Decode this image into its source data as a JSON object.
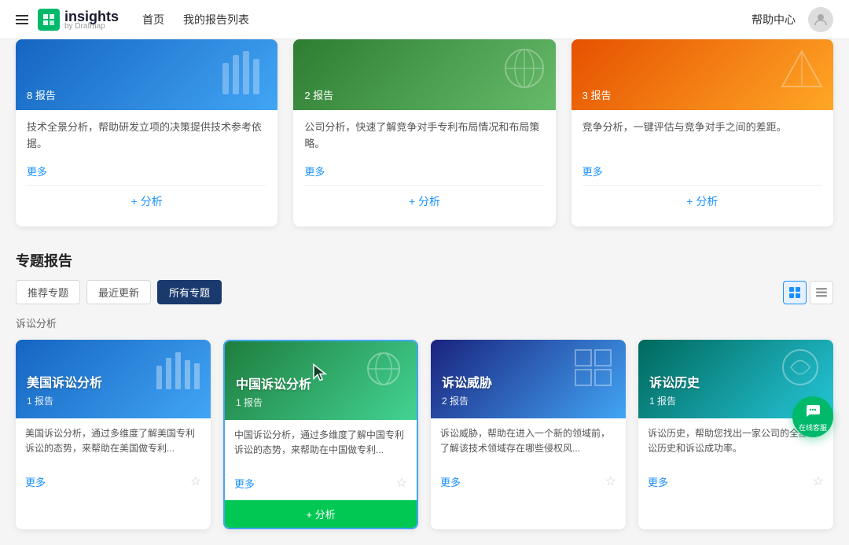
{
  "header": {
    "logo_text": "insights",
    "logo_sub": "by Drafmap",
    "nav_home": "首页",
    "nav_reports": "我的报告列表",
    "help": "帮助中心"
  },
  "top_cards": [
    {
      "report_count": "8 报告",
      "description": "技术全景分析，帮助研发立项的决策提供技术参考依据。",
      "more": "更多",
      "analyze": "+ 分析",
      "color": "blue"
    },
    {
      "report_count": "2 报告",
      "description": "公司分析，快速了解竞争对手专利布局情况和布局策略。",
      "more": "更多",
      "analyze": "+ 分析",
      "color": "green"
    },
    {
      "report_count": "3 报告",
      "description": "竞争分析，一键评估与竞争对手之间的差距。",
      "more": "更多",
      "analyze": "+ 分析",
      "color": "orange"
    }
  ],
  "section": {
    "title": "专题报告",
    "tabs": [
      "推荐专题",
      "最近更新",
      "所有专题"
    ],
    "active_tab": "所有专题",
    "category": "诉讼分析"
  },
  "report_cards": [
    {
      "title": "美国诉讼分析",
      "badge": "1 报告",
      "description": "美国诉讼分析，通过多维度了解美国专利诉讼的态势，来帮助在美国做专利...",
      "more": "更多",
      "color": "blue"
    },
    {
      "title": "中国诉讼分析",
      "badge": "1 报告",
      "description": "中国诉讼分析，通过多维度了解中国专利诉讼的态势，来帮助在中国做专利...",
      "more": "更多",
      "color": "green",
      "highlighted": true
    },
    {
      "title": "诉讼威胁",
      "badge": "2 报告",
      "description": "诉讼威胁，帮助在进入一个新的领域前，了解该技术领域存在哪些侵权风...",
      "more": "更多",
      "color": "blue2"
    },
    {
      "title": "诉讼历史",
      "badge": "1 报告",
      "description": "诉讼历史，帮助您找出一家公司的全部诉讼历史和诉讼成功率。",
      "more": "更多",
      "color": "teal"
    }
  ],
  "chat": {
    "label": "在线客服"
  }
}
